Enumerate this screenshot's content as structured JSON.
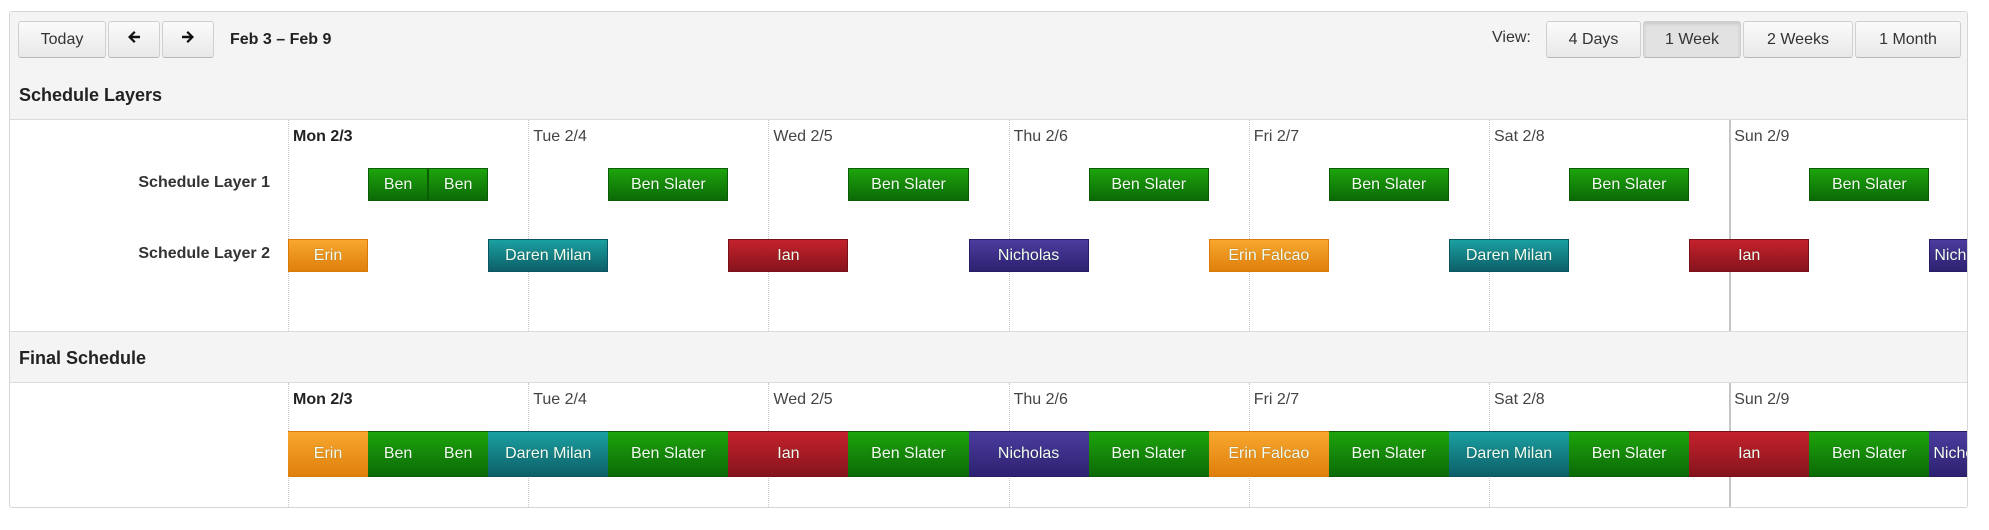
{
  "toolbar": {
    "today_label": "Today",
    "prev_icon": "arrow-left-icon",
    "next_icon": "arrow-right-icon",
    "date_range": "Feb 3 – Feb 9",
    "view_label": "View:",
    "views": [
      {
        "label": "4 Days",
        "active": false
      },
      {
        "label": "1 Week",
        "active": true
      },
      {
        "label": "2 Weeks",
        "active": false
      },
      {
        "label": "1 Month",
        "active": false
      }
    ]
  },
  "days": [
    {
      "label": "Mon 2/3",
      "bold": true
    },
    {
      "label": "Tue 2/4",
      "bold": false
    },
    {
      "label": "Wed 2/5",
      "bold": false
    },
    {
      "label": "Thu 2/6",
      "bold": false
    },
    {
      "label": "Fri 2/7",
      "bold": false
    },
    {
      "label": "Sat 2/8",
      "bold": false
    },
    {
      "label": "Sun 2/9",
      "bold": false,
      "today_marker": true
    }
  ],
  "colors": {
    "green": "#149a0a",
    "orange": "#f0951e",
    "teal": "#167f85",
    "red": "#a81b25",
    "purple": "#3d3088"
  },
  "schedule_layers": {
    "title": "Schedule Layers",
    "layers": [
      {
        "name": "Schedule Layer 1",
        "shifts": [
          {
            "person": "Ben",
            "color": "green",
            "start": "Mon 08:00",
            "end": "Mon 14:00"
          },
          {
            "person": "Ben",
            "color": "green",
            "start": "Mon 14:00",
            "end": "Mon 20:00"
          },
          {
            "person": "Ben Slater",
            "color": "green",
            "start": "Tue 08:00",
            "end": "Tue 20:00"
          },
          {
            "person": "Ben Slater",
            "color": "green",
            "start": "Wed 08:00",
            "end": "Wed 20:00"
          },
          {
            "person": "Ben Slater",
            "color": "green",
            "start": "Thu 08:00",
            "end": "Thu 20:00"
          },
          {
            "person": "Ben Slater",
            "color": "green",
            "start": "Fri 08:00",
            "end": "Fri 20:00"
          },
          {
            "person": "Ben Slater",
            "color": "green",
            "start": "Sat 08:00",
            "end": "Sat 20:00"
          },
          {
            "person": "Ben Slater",
            "color": "green",
            "start": "Sun 08:00",
            "end": "Sun 20:00"
          }
        ]
      },
      {
        "name": "Schedule Layer 2",
        "shifts": [
          {
            "person": "Erin",
            "color": "orange",
            "start": "Mon 00:00",
            "end": "Mon 08:00"
          },
          {
            "person": "Daren Milan",
            "color": "teal",
            "start": "Mon 20:00",
            "end": "Tue 08:00"
          },
          {
            "person": "Ian",
            "color": "red",
            "start": "Tue 20:00",
            "end": "Wed 08:00"
          },
          {
            "person": "Nicholas",
            "color": "purple",
            "start": "Wed 20:00",
            "end": "Thu 08:00"
          },
          {
            "person": "Erin Falcao",
            "color": "orange",
            "start": "Thu 20:00",
            "end": "Fri 08:00"
          },
          {
            "person": "Daren Milan",
            "color": "teal",
            "start": "Fri 20:00",
            "end": "Sat 08:00"
          },
          {
            "person": "Ian",
            "color": "red",
            "start": "Sat 20:00",
            "end": "Sun 08:00"
          },
          {
            "person": "Nicholas",
            "color": "purple",
            "start": "Sun 20:00",
            "end": "Mon 08:00"
          }
        ]
      }
    ]
  },
  "final_schedule": {
    "title": "Final Schedule",
    "shifts": [
      {
        "person": "Erin",
        "color": "orange",
        "start": "Mon 00:00",
        "end": "Mon 08:00"
      },
      {
        "person": "Ben",
        "color": "green",
        "start": "Mon 08:00",
        "end": "Mon 14:00"
      },
      {
        "person": "Ben",
        "color": "green",
        "start": "Mon 14:00",
        "end": "Mon 20:00"
      },
      {
        "person": "Daren Milan",
        "color": "teal",
        "start": "Mon 20:00",
        "end": "Tue 08:00"
      },
      {
        "person": "Ben Slater",
        "color": "green",
        "start": "Tue 08:00",
        "end": "Tue 20:00"
      },
      {
        "person": "Ian",
        "color": "red",
        "start": "Tue 20:00",
        "end": "Wed 08:00"
      },
      {
        "person": "Ben Slater",
        "color": "green",
        "start": "Wed 08:00",
        "end": "Wed 20:00"
      },
      {
        "person": "Nicholas",
        "color": "purple",
        "start": "Wed 20:00",
        "end": "Thu 08:00"
      },
      {
        "person": "Ben Slater",
        "color": "green",
        "start": "Thu 08:00",
        "end": "Thu 20:00"
      },
      {
        "person": "Erin Falcao",
        "color": "orange",
        "start": "Thu 20:00",
        "end": "Fri 08:00"
      },
      {
        "person": "Ben Slater",
        "color": "green",
        "start": "Fri 08:00",
        "end": "Fri 20:00"
      },
      {
        "person": "Daren Milan",
        "color": "teal",
        "start": "Fri 20:00",
        "end": "Sat 08:00"
      },
      {
        "person": "Ben Slater",
        "color": "green",
        "start": "Sat 08:00",
        "end": "Sat 20:00"
      },
      {
        "person": "Ian",
        "color": "red",
        "start": "Sat 20:00",
        "end": "Sun 08:00"
      },
      {
        "person": "Ben Slater",
        "color": "green",
        "start": "Sun 08:00",
        "end": "Sun 20:00"
      },
      {
        "person": "Nicholas",
        "color": "purple",
        "start": "Sun 20:00",
        "end": "Mon 08:00"
      }
    ]
  }
}
